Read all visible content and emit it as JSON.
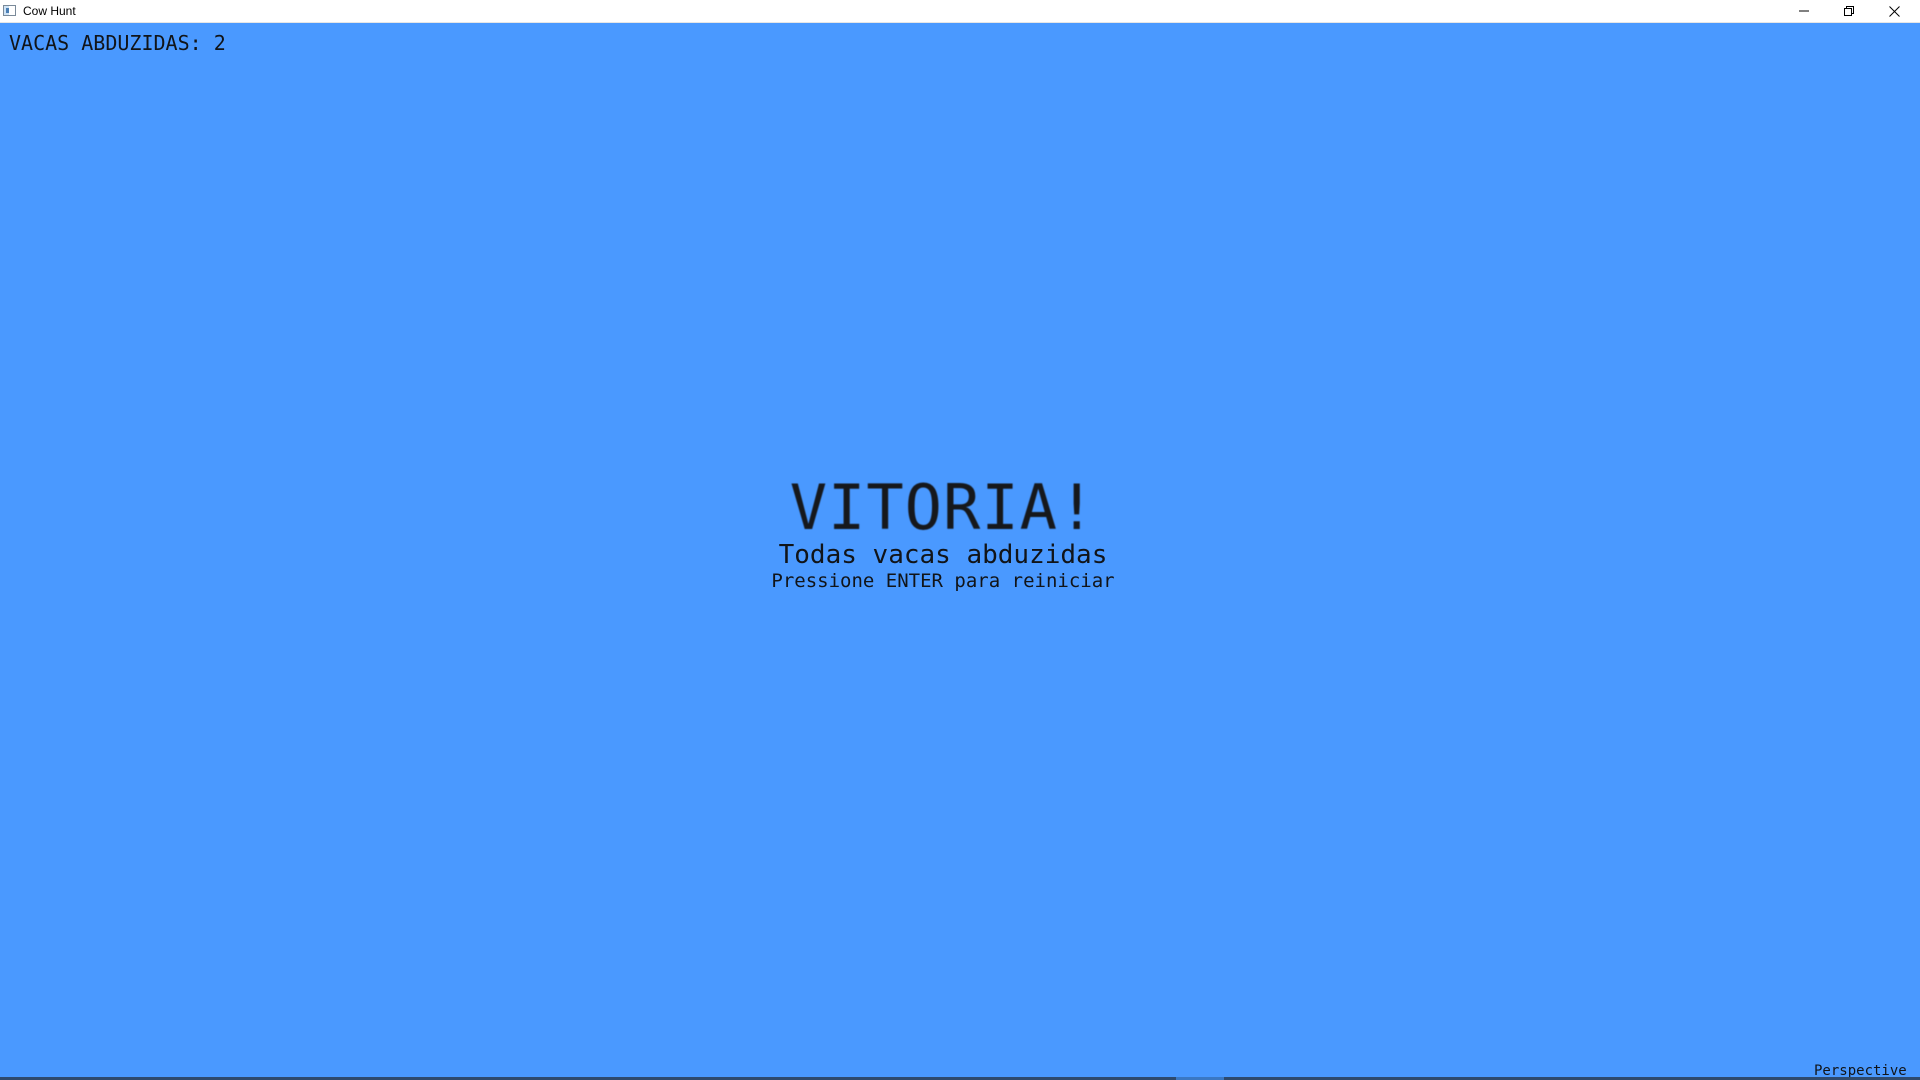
{
  "window": {
    "title": "Cow Hunt",
    "icon": "app-window-icon",
    "controls": {
      "minimize_icon": "minimize-icon",
      "maximize_icon": "restore-icon",
      "close_icon": "close-icon"
    }
  },
  "hud": {
    "counter_label": "VACAS ABDUZIDAS: 2"
  },
  "victory": {
    "title": "VITORIA!",
    "subtitle": "Todas vacas abduzidas",
    "hint": "Pressione ENTER para reiniciar"
  },
  "projection_mode": "Perspective",
  "colors": {
    "background": "#4a99ff",
    "text": "#111418",
    "titlebar": "#ffffff"
  }
}
